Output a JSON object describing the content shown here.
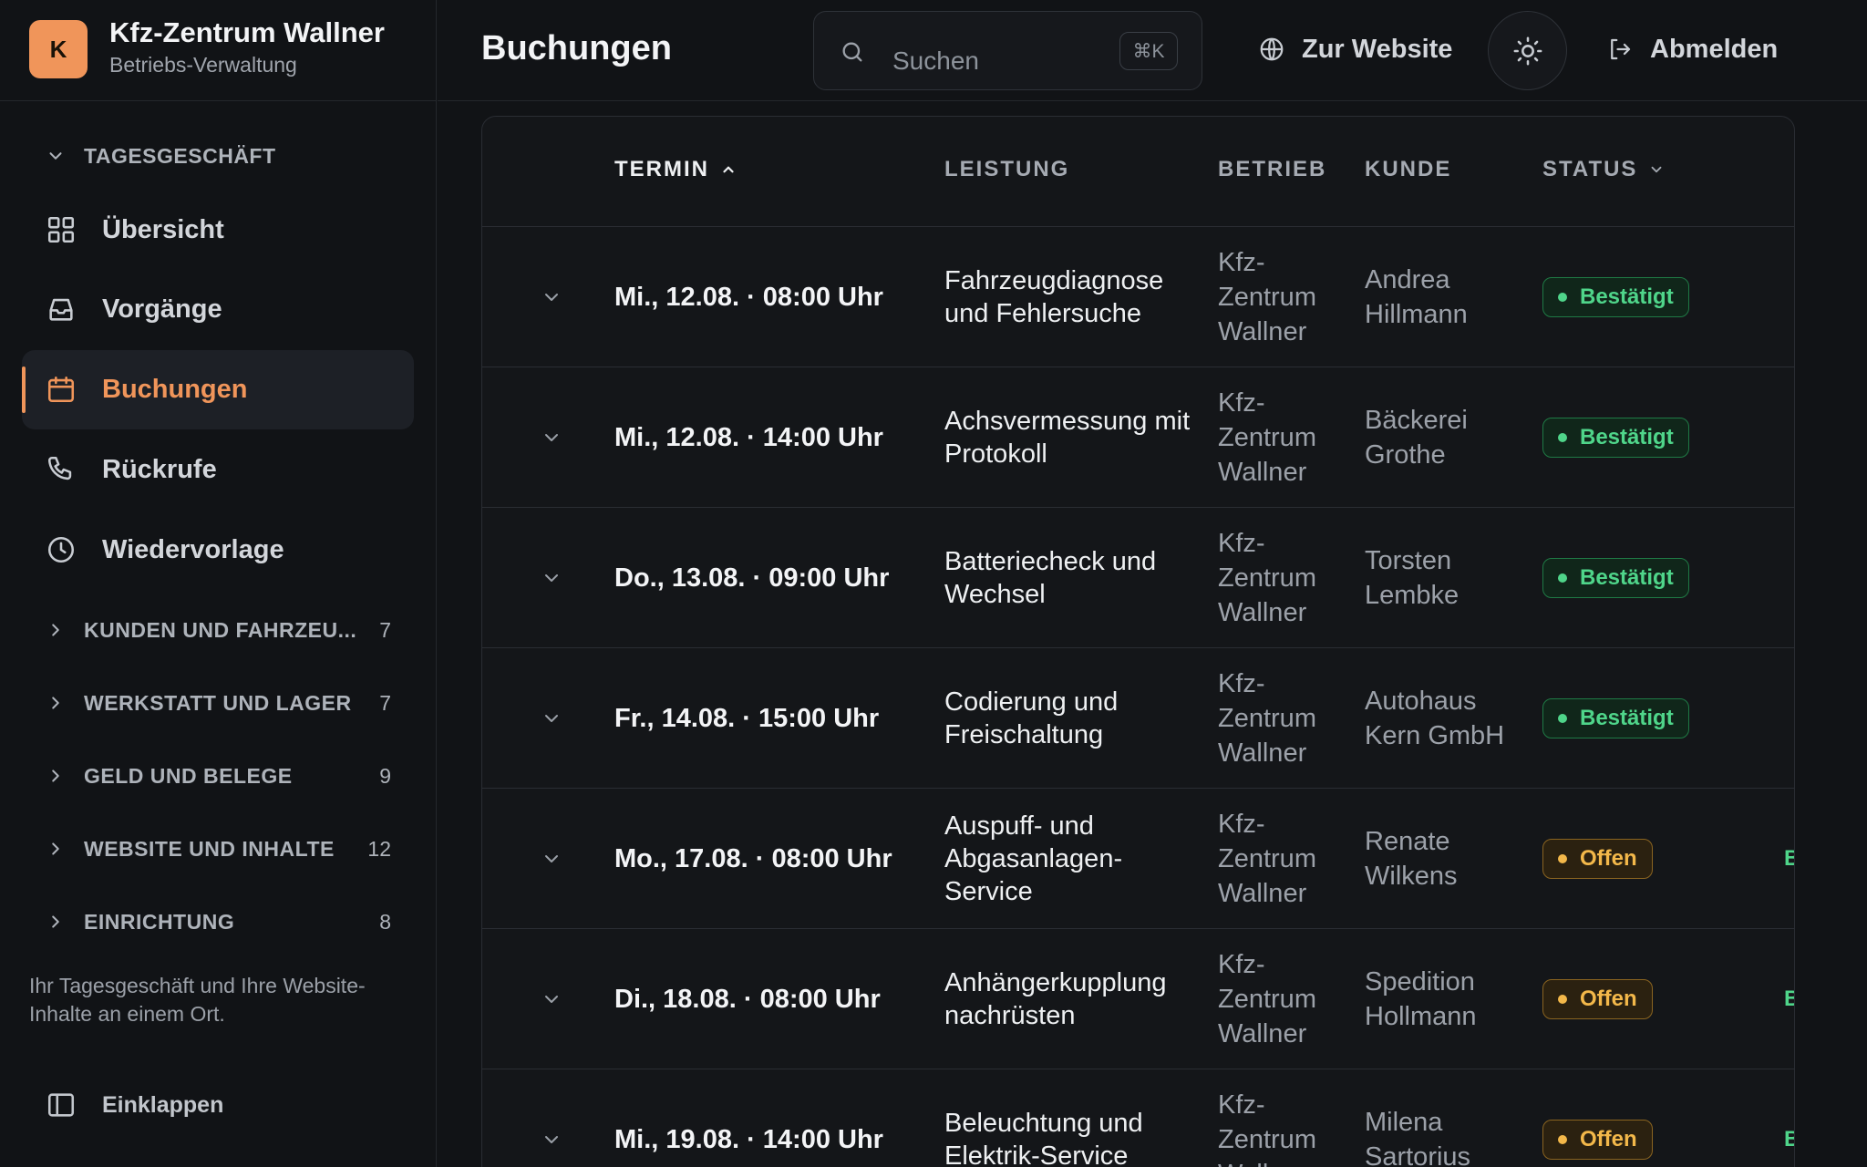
{
  "brand": {
    "logo_letter": "K",
    "name": "Kfz-Zentrum Wallner",
    "subtitle": "Betriebs-Verwaltung"
  },
  "sidebar": {
    "tagesgeschaeft_label": "TAGESGESCHÄFT",
    "items": [
      {
        "label": "Übersicht",
        "icon": "grid-icon"
      },
      {
        "label": "Vorgänge",
        "icon": "inbox-icon"
      },
      {
        "label": "Buchungen",
        "icon": "calendar-icon",
        "active": true
      },
      {
        "label": "Rückrufe",
        "icon": "phone-icon"
      },
      {
        "label": "Wiedervorlage",
        "icon": "clock-icon"
      }
    ],
    "groups": [
      {
        "label": "KUNDEN UND FAHRZEU...",
        "count": "7"
      },
      {
        "label": "WERKSTATT UND LAGER",
        "count": "7"
      },
      {
        "label": "GELD UND BELEGE",
        "count": "9"
      },
      {
        "label": "WEBSITE UND INHALTE",
        "count": "12"
      },
      {
        "label": "EINRICHTUNG",
        "count": "8"
      }
    ],
    "note": "Ihr Tagesgeschäft und Ihre Website-Inhalte an einem Ort.",
    "collapse_label": "Einklappen"
  },
  "topbar": {
    "title": "Buchungen",
    "search_placeholder": "Suchen",
    "search_shortcut": "⌘K",
    "website_label": "Zur Website",
    "logout_label": "Abmelden"
  },
  "table": {
    "columns": {
      "termin": "TERMIN",
      "leistung": "LEISTUNG",
      "betrieb": "BETRIEB",
      "kunde": "KUNDE",
      "status": "STATUS"
    },
    "rows": [
      {
        "termin": "Mi., 12.08. · 08:00 Uhr",
        "leistung": "Fahrzeugdiagnose und Fehlersuche",
        "betrieb": "Kfz-Zentrum Wallner",
        "kunde": "Andrea Hillmann",
        "status": "Bestätigt",
        "status_type": "ok",
        "extra": ""
      },
      {
        "termin": "Mi., 12.08. · 14:00 Uhr",
        "leistung": "Achsvermessung mit Protokoll",
        "betrieb": "Kfz-Zentrum Wallner",
        "kunde": "Bäckerei Grothe",
        "status": "Bestätigt",
        "status_type": "ok",
        "extra": ""
      },
      {
        "termin": "Do., 13.08. · 09:00 Uhr",
        "leistung": "Batteriecheck und Wechsel",
        "betrieb": "Kfz-Zentrum Wallner",
        "kunde": "Torsten Lembke",
        "status": "Bestätigt",
        "status_type": "ok",
        "extra": ""
      },
      {
        "termin": "Fr., 14.08. · 15:00 Uhr",
        "leistung": "Codierung und Freischaltung",
        "betrieb": "Kfz-Zentrum Wallner",
        "kunde": "Autohaus Kern GmbH",
        "status": "Bestätigt",
        "status_type": "ok",
        "extra": ""
      },
      {
        "termin": "Mo., 17.08. · 08:00 Uhr",
        "leistung": "Auspuff- und Abgasanlagen-Service",
        "betrieb": "Kfz-Zentrum Wallner",
        "kunde": "Renate Wilkens",
        "status": "Offen",
        "status_type": "open",
        "extra": "B"
      },
      {
        "termin": "Di., 18.08. · 08:00 Uhr",
        "leistung": "Anhängerkupplung nachrüsten",
        "betrieb": "Kfz-Zentrum Wallner",
        "kunde": "Spedition Hollmann",
        "status": "Offen",
        "status_type": "open",
        "extra": "B"
      },
      {
        "termin": "Mi., 19.08. · 14:00 Uhr",
        "leistung": "Beleuchtung und Elektrik-Service",
        "betrieb": "Kfz-Zentrum Wallner",
        "kunde": "Milena Sartorius",
        "status": "Offen",
        "status_type": "open",
        "extra": "B"
      }
    ]
  },
  "colors": {
    "accent": "#f0955a",
    "success": "#4fd58a",
    "warning": "#f3b84a",
    "background": "#111316"
  }
}
